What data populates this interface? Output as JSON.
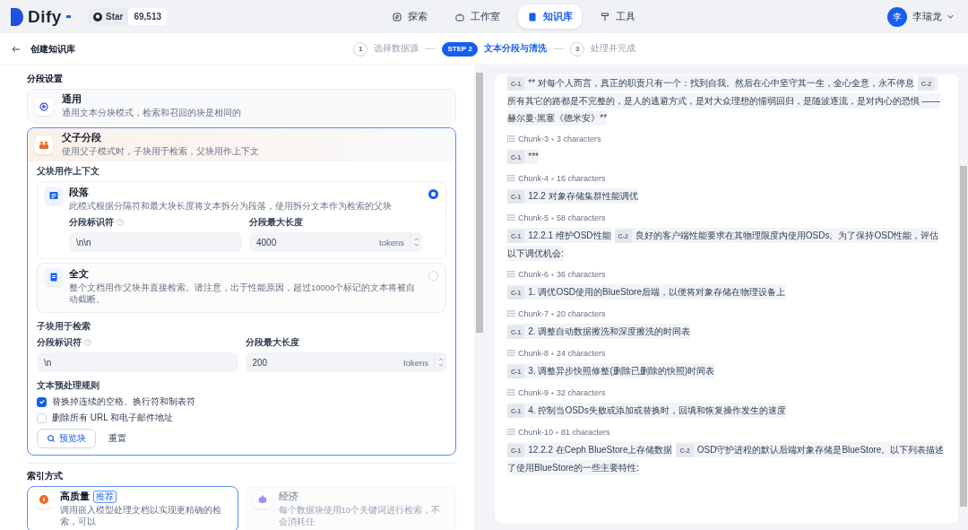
{
  "nav": {
    "logo": "Dify",
    "star_label": "Star",
    "star_count": "69,513",
    "items": [
      {
        "kind": "explore",
        "label": "探索",
        "selected": false
      },
      {
        "kind": "studio",
        "label": "工作室",
        "selected": false
      },
      {
        "kind": "knowledge",
        "label": "知识库",
        "selected": true
      },
      {
        "kind": "tools",
        "label": "工具",
        "selected": false
      }
    ],
    "user": {
      "avatar": "李",
      "name": "李瑞龙"
    }
  },
  "header": {
    "title": "创建知识库",
    "steps": [
      {
        "number": "1",
        "label": "选择数据源",
        "selected": false
      },
      {
        "number": "STEP 2",
        "label": "文本分段与清洗",
        "selected": true
      },
      {
        "number": "3",
        "label": "处理并完成",
        "selected": false
      }
    ]
  },
  "settings": {
    "title": "分段设置",
    "modes": [
      {
        "kind": "general",
        "title": "通用",
        "description": "通用文本分块模式，检索和召回的块是相同的",
        "selected": false
      },
      {
        "kind": "parent-child",
        "title": "父子分段",
        "description": "使用父子模式时，子块用于检索，父块用作上下文",
        "selected": true
      }
    ],
    "parent": {
      "title": "父块用作上下文",
      "options": [
        {
          "kind": "paragraph",
          "title": "段落",
          "description": "此模式根据分隔符和最大块长度将文本拆分为段落，使用拆分文本作为检索的父块",
          "selected": true,
          "fields": [
            {
              "label": "分段标识符",
              "help": true,
              "value": "\\n\\n"
            },
            {
              "label": "分段最大长度",
              "help": false,
              "value": "4000",
              "unit": "tokens"
            }
          ]
        },
        {
          "kind": "fulltext",
          "title": "全文",
          "description": "整个文档用作父块并直接检索。请注意，出于性能原因，超过10000个标记的文本将被自动截断。",
          "selected": false
        }
      ]
    },
    "child": {
      "title": "子块用于检索",
      "fields": [
        {
          "label": "分段标识符",
          "help": true,
          "value": "\\n"
        },
        {
          "label": "分段最大长度",
          "help": false,
          "value": "200",
          "unit": "tokens"
        }
      ]
    },
    "rules": {
      "title": "文本预处理规则",
      "items": [
        {
          "label": "替换掉连续的空格、换行符和制表符",
          "checked": true
        },
        {
          "label": "删除所有 URL 和电子邮件地址",
          "checked": false
        }
      ]
    },
    "preview_button": "预览块",
    "reset_button": "重置"
  },
  "index": {
    "title": "索引方式",
    "options": [
      {
        "kind": "high",
        "title": "高质量",
        "badge": "推荐",
        "description": "调用嵌入模型处理文档以实现更精确的检索，可以",
        "selected": true
      },
      {
        "kind": "economy",
        "title": "经济",
        "description": "每个数据块使用10个关键词进行检索，不会消耗任",
        "selected": false
      }
    ]
  },
  "preview": {
    "chunks": [
      {
        "segments": [
          {
            "label": "C-1",
            "text": "** 对每个人而言，真正的职责只有一个：找到自我。然后在心中坚守其一生，全心全意，永不停息"
          },
          {
            "label": "C-2",
            "text": "所有其它的路都是不完整的，是人的逃避方式，是对大众理想的懦弱回归，是随波逐流，是对内心的恐惧 ——赫尔曼·黑塞《德米安》**"
          }
        ]
      },
      {
        "name": "Chunk-3",
        "size": "3 characters",
        "segments": [
          {
            "label": "C-1",
            "text": "***"
          }
        ]
      },
      {
        "name": "Chunk-4",
        "size": "16 characters",
        "segments": [
          {
            "label": "C-1",
            "text": "12.2 对象存储集群性能调优"
          }
        ]
      },
      {
        "name": "Chunk-5",
        "size": "58 characters",
        "segments": [
          {
            "label": "C-1",
            "text": "12.2.1 维护OSD性能"
          },
          {
            "label": "C-2",
            "text": "良好的客户端性能要求在其物理限度内使用OSDs。为了保持OSD性能，评估以下调优机会:"
          }
        ]
      },
      {
        "name": "Chunk-6",
        "size": "36 characters",
        "segments": [
          {
            "label": "C-1",
            "text": "1. 调优OSD使用的BlueStore后端，以便将对象存储在物理设备上"
          }
        ]
      },
      {
        "name": "Chunk-7",
        "size": "20 characters",
        "segments": [
          {
            "label": "C-1",
            "text": "2. 调整自动数据擦洗和深度擦洗的时间表"
          }
        ]
      },
      {
        "name": "Chunk-8",
        "size": "24 characters",
        "segments": [
          {
            "label": "C-1",
            "text": "3. 调整异步快照修整(删除已删除的快照)时间表"
          }
        ]
      },
      {
        "name": "Chunk-9",
        "size": "32 characters",
        "segments": [
          {
            "label": "C-1",
            "text": "4. 控制当OSDs失败或添加或替换时，回填和恢复操作发生的速度"
          }
        ]
      },
      {
        "name": "Chunk-10",
        "size": "81 characters",
        "segments": [
          {
            "label": "C-1",
            "text": "12.2.2 在Ceph BlueStore上存储数据"
          },
          {
            "label": "C-2",
            "text": "OSD守护进程的默认后端对象存储是BlueStore。以下列表描述了使用BlueStore的一些主要特性:"
          }
        ]
      }
    ]
  }
}
